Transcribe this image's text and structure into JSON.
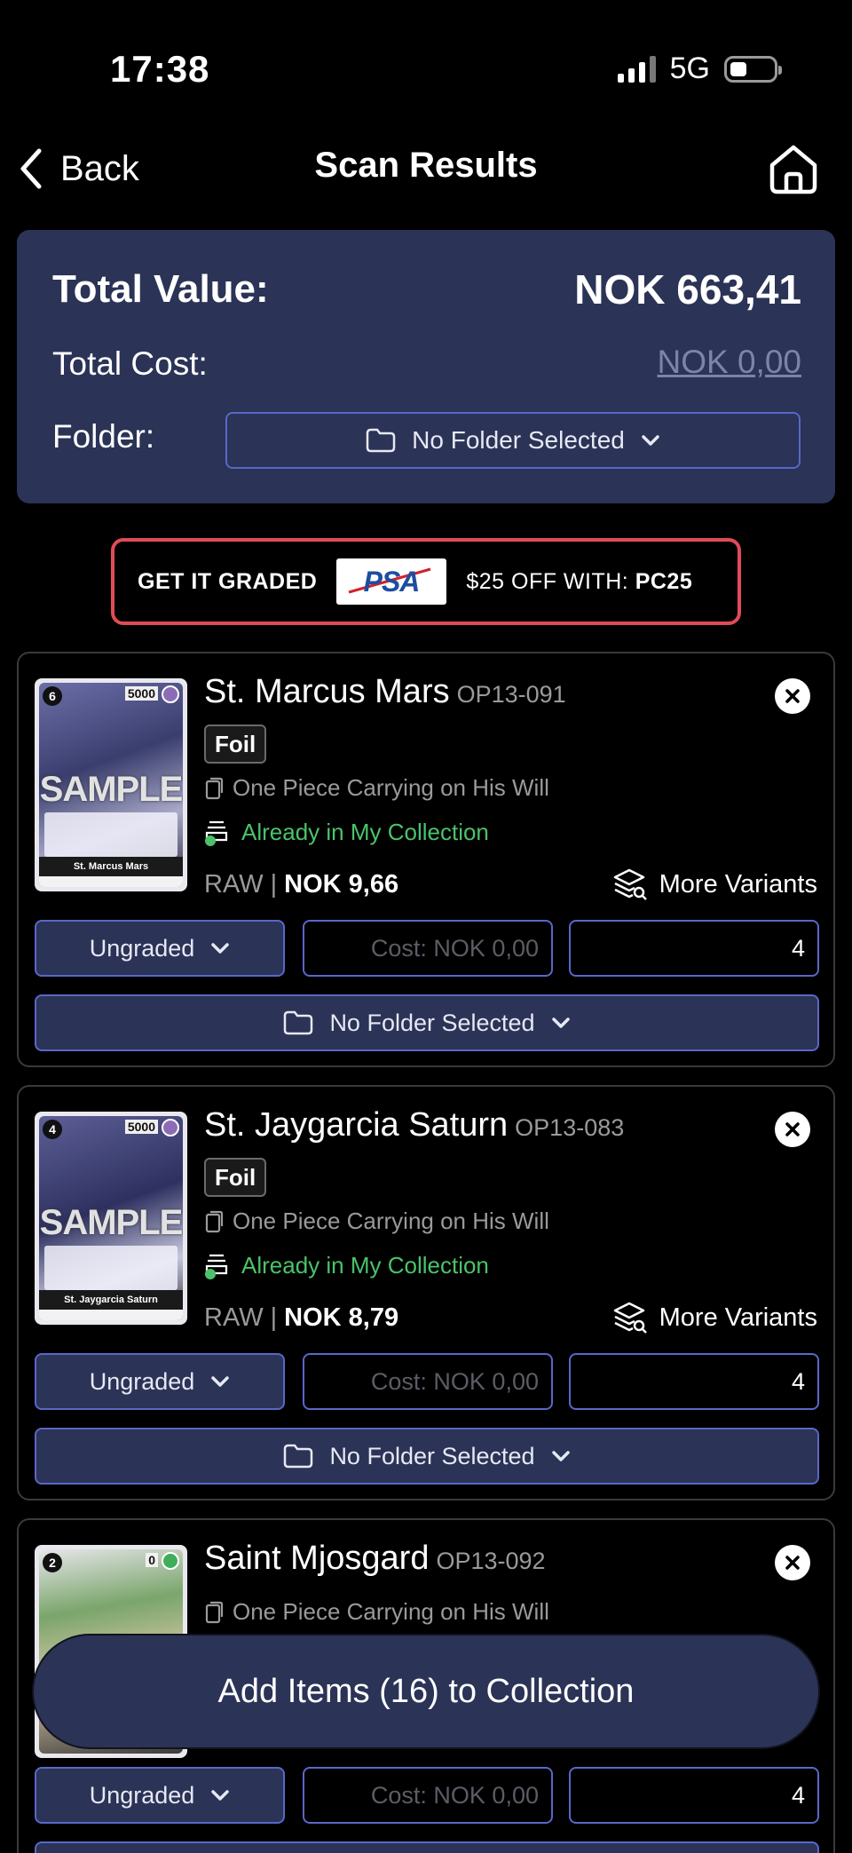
{
  "status": {
    "time": "17:38",
    "network": "5G"
  },
  "nav": {
    "back_label": "Back",
    "title": "Scan Results"
  },
  "summary": {
    "total_value_label": "Total Value:",
    "total_value": "NOK 663,41",
    "total_cost_label": "Total Cost:",
    "total_cost": "NOK 0,00",
    "folder_label": "Folder:",
    "folder_value": "No Folder Selected"
  },
  "banner": {
    "left_text": "GET IT GRADED",
    "logo_text": "PSA",
    "offer_text": "$25 OFF WITH:",
    "code": "PC25",
    "border_color": "#e04b58"
  },
  "cards": [
    {
      "name": "St. Marcus Mars",
      "code": "OP13-091",
      "foil_label": "Foil",
      "set": "One Piece Carrying on His Will",
      "collection_status": "Already in My Collection",
      "condition": "RAW",
      "price": "NOK 9,66",
      "variants_label": "More Variants",
      "grade": "Ungraded",
      "cost_placeholder": "Cost: NOK 0,00",
      "quantity": "4",
      "folder": "No Folder Selected",
      "image": {
        "cost": "6",
        "power": "5000",
        "watermark": "SAMPLE",
        "caption": "St. Marcus Mars"
      }
    },
    {
      "name": "St. Jaygarcia Saturn",
      "code": "OP13-083",
      "foil_label": "Foil",
      "set": "One Piece Carrying on His Will",
      "collection_status": "Already in My Collection",
      "condition": "RAW",
      "price": "NOK 8,79",
      "variants_label": "More Variants",
      "grade": "Ungraded",
      "cost_placeholder": "Cost: NOK 0,00",
      "quantity": "4",
      "folder": "No Folder Selected",
      "image": {
        "cost": "4",
        "power": "5000",
        "watermark": "SAMPLE",
        "caption": "St. Jaygarcia Saturn"
      }
    },
    {
      "name": "Saint Mjosgard",
      "code": "OP13-092",
      "set": "One Piece Carrying on His Will",
      "grade": "Ungraded",
      "cost_placeholder": "Cost: NOK 0,00",
      "quantity": "4",
      "image": {
        "cost": "2",
        "power": "0"
      }
    }
  ],
  "add_button_label": "Add Items (16) to Collection",
  "colors": {
    "panel": "#2b3356",
    "accent_border": "#5a67c9",
    "owned_green": "#4bc26a"
  }
}
